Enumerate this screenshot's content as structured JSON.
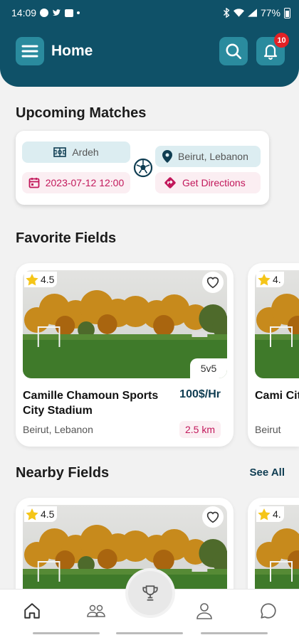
{
  "status_bar": {
    "time": "14:09",
    "battery": "77%"
  },
  "header": {
    "title": "Home",
    "notification_count": "10"
  },
  "upcoming": {
    "title": "Upcoming Matches",
    "match": {
      "team": "Ardeh",
      "datetime": "2023-07-12 12:00",
      "location": "Beirut, Lebanon",
      "directions_label": "Get Directions"
    }
  },
  "favorites": {
    "title": "Favorite Fields",
    "fields": [
      {
        "rating": "4.5",
        "size": "5v5",
        "name": "Camille Chamoun Sports City Stadium",
        "price": "100$/Hr",
        "location": "Beirut, Lebanon",
        "distance": "2.5 km"
      },
      {
        "rating": "4.",
        "name": "Cami City S",
        "location": "Beirut"
      }
    ]
  },
  "nearby": {
    "title": "Nearby Fields",
    "see_all": "See All",
    "fields": [
      {
        "rating": "4.5"
      },
      {
        "rating": "4."
      }
    ]
  },
  "icons": {
    "menu": "menu-icon",
    "search": "search-icon",
    "bell": "bell-icon",
    "home": "home-icon",
    "teams": "users-icon",
    "trophy": "trophy-icon",
    "profile": "user-icon",
    "chat": "chat-icon"
  },
  "colors": {
    "primary": "#0f5168",
    "accent": "#c2185b",
    "badge": "#e32125",
    "star": "#f5c518"
  }
}
